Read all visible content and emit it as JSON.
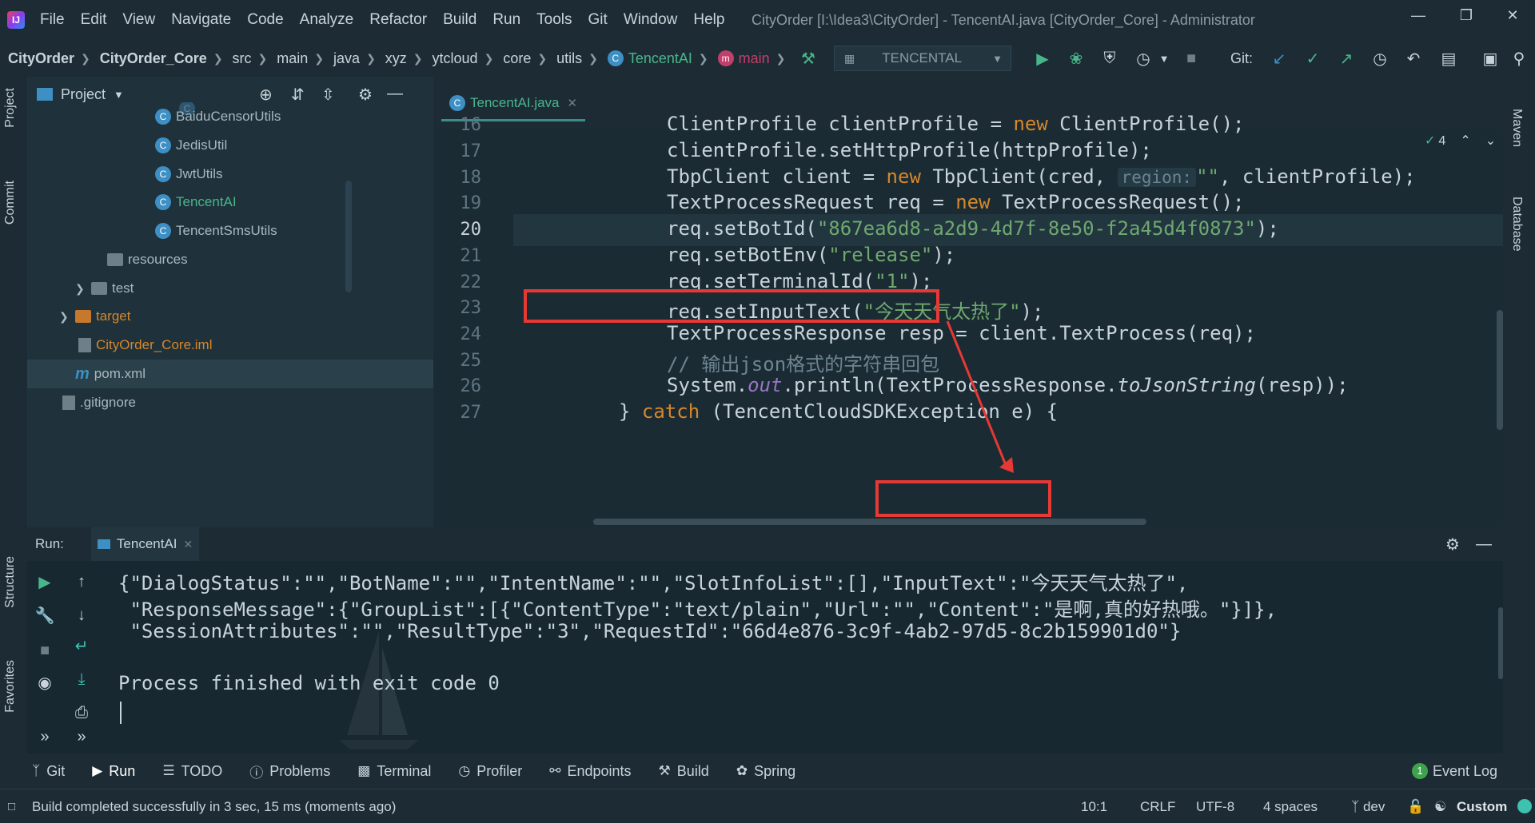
{
  "window": {
    "title": "CityOrder [I:\\Idea3\\CityOrder] - TencentAI.java [CityOrder_Core] - Administrator",
    "menu": [
      "File",
      "Edit",
      "View",
      "Navigate",
      "Code",
      "Analyze",
      "Refactor",
      "Build",
      "Run",
      "Tools",
      "Git",
      "Window",
      "Help"
    ]
  },
  "breadcrumbs": [
    "CityOrder",
    "CityOrder_Core",
    "src",
    "main",
    "java",
    "xyz",
    "ytcloud",
    "core",
    "utils",
    "TencentAI",
    "main"
  ],
  "run_config": "TENCENTAL",
  "git_label": "Git:",
  "left_strip": [
    "Project",
    "Commit",
    "Structure",
    "Favorites"
  ],
  "right_strip": [
    "Maven",
    "Database"
  ],
  "project": {
    "header": "Project",
    "tree": [
      {
        "label": "BaiduCensorUtils",
        "type": "class"
      },
      {
        "label": "JedisUtil",
        "type": "class"
      },
      {
        "label": "JwtUtils",
        "type": "class"
      },
      {
        "label": "TencentAI",
        "type": "class",
        "highlight": true
      },
      {
        "label": "TencentSmsUtils",
        "type": "class"
      },
      {
        "label": "resources",
        "type": "folder"
      },
      {
        "label": "test",
        "type": "folder"
      },
      {
        "label": "target",
        "type": "folder-orange"
      },
      {
        "label": "CityOrder_Core.iml",
        "type": "iml"
      },
      {
        "label": "pom.xml",
        "type": "maven"
      },
      {
        "label": ".gitignore",
        "type": "file"
      }
    ]
  },
  "editor": {
    "tab": "TencentAI.java",
    "inspections": "4",
    "line_numbers": [
      "16",
      "17",
      "18",
      "19",
      "20",
      "21",
      "22",
      "23",
      "24",
      "25",
      "26",
      "27"
    ],
    "current_line": "20",
    "lines": {
      "l16": {
        "a": "ClientProfile clientProfile = ",
        "kw": "new",
        "b": " ClientProfile();"
      },
      "l17": "clientProfile.setHttpProfile(httpProfile);",
      "l18": {
        "a": "TbpClient client = ",
        "kw": "new",
        "b": " TbpClient(cred, ",
        "hint": "region:",
        "str": "\"\"",
        "c": ", clientProfile);"
      },
      "l19": {
        "a": "TextProcessRequest req = ",
        "kw": "new",
        "b": " TextProcessRequest();"
      },
      "l20": {
        "a": "req.setBotId(",
        "str": "\"867ea6d8-a2d9-4d7f-8e50-f2a45d4f0873\"",
        "b": ");"
      },
      "l21": {
        "a": "req.setBotEnv(",
        "str": "\"release\"",
        "b": ");"
      },
      "l22": {
        "a": "req.setTerminalId(",
        "str": "\"1\"",
        "b": ");"
      },
      "l23": {
        "a": "req.setInputText(",
        "str": "\"今天天气太热了\"",
        "b": ");"
      },
      "l24": "TextProcessResponse resp = client.TextProcess(req);",
      "l25": "// 输出json格式的字符串回包",
      "l26": {
        "a": "System.",
        "fld": "out",
        "b": ".println(TextProcessResponse.",
        "it": "toJsonString",
        "c": "(resp));"
      },
      "l27": {
        "a": "} ",
        "kw": "catch",
        "b": " (TencentCloudSDKException e) {"
      }
    }
  },
  "run": {
    "label": "Run:",
    "tab": "TencentAI",
    "output": [
      "{\"DialogStatus\":\"\",\"BotName\":\"\",\"IntentName\":\"\",\"SlotInfoList\":[],\"InputText\":\"今天天气太热了\",",
      " \"ResponseMessage\":{\"GroupList\":[{\"ContentType\":\"text/plain\",\"Url\":\"\",\"Content\":\"是啊,真的好热哦。\"}]},",
      " \"SessionAttributes\":\"\",\"ResultType\":\"3\",\"RequestId\":\"66d4e876-3c9f-4ab2-97d5-8c2b159901d0\"}",
      "",
      "Process finished with exit code 0"
    ]
  },
  "bottom_tools": [
    {
      "label": "Git",
      "icon": "branch-icon"
    },
    {
      "label": "Run",
      "icon": "play-icon",
      "active": true
    },
    {
      "label": "TODO",
      "icon": "list-icon"
    },
    {
      "label": "Problems",
      "icon": "info-icon"
    },
    {
      "label": "Terminal",
      "icon": "terminal-icon"
    },
    {
      "label": "Profiler",
      "icon": "profiler-icon"
    },
    {
      "label": "Endpoints",
      "icon": "endpoints-icon"
    },
    {
      "label": "Build",
      "icon": "hammer-icon"
    },
    {
      "label": "Spring",
      "icon": "spring-icon"
    }
  ],
  "event_log": {
    "count": "1",
    "label": "Event Log"
  },
  "status": {
    "message": "Build completed successfully in 3 sec, 15 ms (moments ago)",
    "position": "10:1",
    "line_sep": "CRLF",
    "encoding": "UTF-8",
    "indent": "4 spaces",
    "branch": "dev",
    "theme": "Custom Theme"
  }
}
